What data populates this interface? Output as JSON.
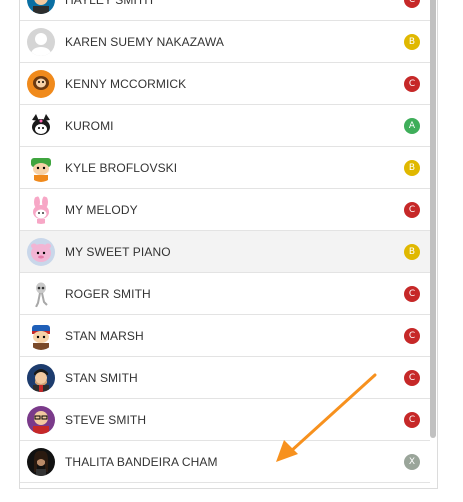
{
  "contacts": [
    {
      "name": "HAYLEY SMITH",
      "badge": "C",
      "badge_color": "#c62828",
      "avatar": "hayley-avatar"
    },
    {
      "name": "KAREN SUEMY NAKAZAWA",
      "badge": "B",
      "badge_color": "#e0b800",
      "avatar": "default-avatar"
    },
    {
      "name": "KENNY MCCORMICK",
      "badge": "C",
      "badge_color": "#c62828",
      "avatar": "kenny-avatar"
    },
    {
      "name": "KUROMI",
      "badge": "A",
      "badge_color": "#3fae5a",
      "avatar": "kuromi-avatar"
    },
    {
      "name": "KYLE BROFLOVSKI",
      "badge": "B",
      "badge_color": "#e0b800",
      "avatar": "kyle-avatar"
    },
    {
      "name": "MY MELODY",
      "badge": "C",
      "badge_color": "#c62828",
      "avatar": "my-melody-avatar"
    },
    {
      "name": "MY SWEET PIANO",
      "badge": "B",
      "badge_color": "#e0b800",
      "avatar": "my-sweet-piano-avatar"
    },
    {
      "name": "ROGER SMITH",
      "badge": "C",
      "badge_color": "#c62828",
      "avatar": "roger-avatar"
    },
    {
      "name": "STAN MARSH",
      "badge": "C",
      "badge_color": "#c62828",
      "avatar": "stan-marsh-avatar"
    },
    {
      "name": "STAN SMITH",
      "badge": "C",
      "badge_color": "#c62828",
      "avatar": "stan-smith-avatar"
    },
    {
      "name": "STEVE SMITH",
      "badge": "C",
      "badge_color": "#c62828",
      "avatar": "steve-avatar"
    },
    {
      "name": "THALITA BANDEIRA CHAM",
      "badge": "X",
      "badge_color": "#9aa59a",
      "avatar": "thalita-avatar"
    }
  ],
  "colors": {
    "arrow": "#f7911e",
    "highlight_row": "#f3f3f3",
    "text": "#333333"
  }
}
